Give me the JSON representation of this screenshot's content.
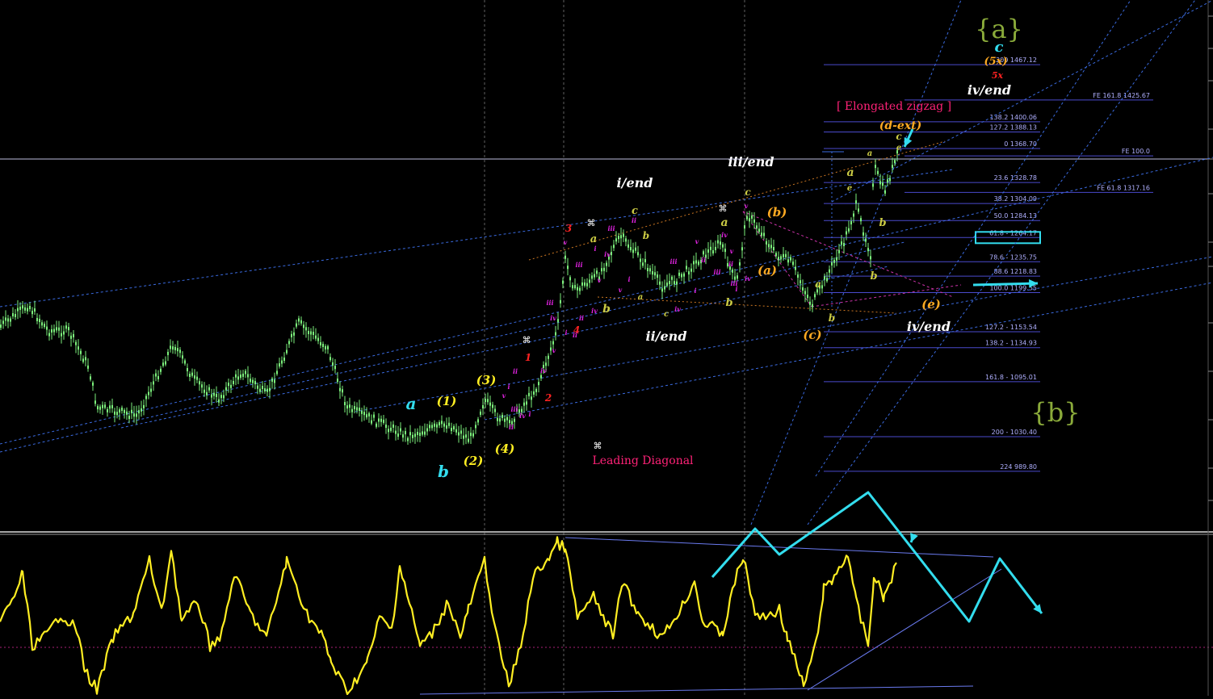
{
  "chart_data": {
    "type": "line",
    "title": "",
    "grid": false,
    "price_range": [
      960,
      1480
    ],
    "indicator_range": [
      0,
      100
    ],
    "fib_levels": [
      {
        "label": "200 1467.12",
        "price": 1467.12
      },
      {
        "label": "FE 161.8 1425.67",
        "price": 1425.67
      },
      {
        "label": "138.2 1400.06",
        "price": 1400.06
      },
      {
        "label": "127.2 1388.13",
        "price": 1388.13
      },
      {
        "label": "0 1368.70",
        "price": 1368.7
      },
      {
        "label": "FE 100.0",
        "price": 1360.0
      },
      {
        "label": "23.6 1328.78",
        "price": 1328.78
      },
      {
        "label": "FE 61.8 1317.16",
        "price": 1317.16
      },
      {
        "label": "38.2 1304.09",
        "price": 1304.09
      },
      {
        "label": "50.0 1284.13",
        "price": 1284.13
      },
      {
        "label": "61.8 - 1264.17",
        "price": 1264.17
      },
      {
        "label": "78.6 - 1235.75",
        "price": 1235.75
      },
      {
        "label": "88.6 1218.83",
        "price": 1218.83
      },
      {
        "label": "100.0 1199.55",
        "price": 1199.55
      },
      {
        "label": "127.2 - 1153.54",
        "price": 1153.54
      },
      {
        "label": "138.2 - 1134.93",
        "price": 1134.93
      },
      {
        "label": "161.8 - 1095.01",
        "price": 1095.01
      },
      {
        "label": "200 - 1030.40",
        "price": 1030.4
      },
      {
        "label": "224 989.80",
        "price": 989.8
      }
    ],
    "wave_labels": [
      {
        "text": "{a}",
        "color": "#8aaa3a"
      },
      {
        "text": "{b}",
        "color": "#8aaa3a"
      },
      {
        "text": "c",
        "color": "#33ddee"
      },
      {
        "text": "(5x)",
        "color": "#ffaa22"
      },
      {
        "text": "5x",
        "color": "#ff2222"
      },
      {
        "text": "iv/end",
        "color": "#ffffff"
      },
      {
        "text": "[ Elongated zigzag ]",
        "color": "#ff2277"
      },
      {
        "text": "(d-ext)",
        "color": "#ffaa22"
      },
      {
        "text": "c",
        "color": "#cccc44"
      },
      {
        "text": "e",
        "color": "#cccc44"
      },
      {
        "text": "a",
        "color": "#cccc44"
      },
      {
        "text": "a",
        "color": "#cccc44"
      },
      {
        "text": "e",
        "color": "#cccc44"
      },
      {
        "text": "b",
        "color": "#cccc44"
      },
      {
        "text": "b",
        "color": "#cccc44"
      },
      {
        "text": "iii/end",
        "color": "#ffffff"
      },
      {
        "text": "c",
        "color": "#cccc44"
      },
      {
        "text": "(b)",
        "color": "#ffaa22"
      },
      {
        "text": "a",
        "color": "#cccc44"
      },
      {
        "text": "(a)",
        "color": "#ffaa22"
      },
      {
        "text": "a",
        "color": "#cccc44"
      },
      {
        "text": "b",
        "color": "#cccc44"
      },
      {
        "text": "(c)",
        "color": "#ffaa22"
      },
      {
        "text": "(e)",
        "color": "#ffaa22"
      },
      {
        "text": "iv/end",
        "color": "#ffffff"
      },
      {
        "text": "i/end",
        "color": "#ffffff"
      },
      {
        "text": "c",
        "color": "#cccc44"
      },
      {
        "text": "a",
        "color": "#cccc44"
      },
      {
        "text": "b",
        "color": "#cccc44"
      },
      {
        "text": "b",
        "color": "#cccc44"
      },
      {
        "text": "a",
        "color": "#cccc44"
      },
      {
        "text": "c",
        "color": "#cccc44"
      },
      {
        "text": "b",
        "color": "#cccc44"
      },
      {
        "text": "ii/end",
        "color": "#ffffff"
      },
      {
        "text": "3",
        "color": "#ff2222"
      },
      {
        "text": "4",
        "color": "#ff2222"
      },
      {
        "text": "1",
        "color": "#ff2222"
      },
      {
        "text": "2",
        "color": "#ff2222"
      },
      {
        "text": "a",
        "color": "#33ddee"
      },
      {
        "text": "b",
        "color": "#33ddee"
      },
      {
        "text": "(1)",
        "color": "#ffee22"
      },
      {
        "text": "(2)",
        "color": "#ffee22"
      },
      {
        "text": "(3)",
        "color": "#ffee22"
      },
      {
        "text": "(4)",
        "color": "#ffee22"
      },
      {
        "text": "Leading Diagonal",
        "color": "#ff2277"
      }
    ],
    "micro_labels": [
      "iii",
      "iv",
      "v",
      "i",
      "ii",
      "iii",
      "iv",
      "v",
      "i",
      "ii",
      "iii",
      "iv",
      "v",
      "i",
      "ii",
      "iii",
      "iv",
      "v",
      "i",
      "ii",
      "iii",
      "iv",
      "v",
      "i",
      "ii",
      "iii",
      "iv",
      "v",
      "i",
      "ii",
      "iii",
      "iv",
      "v",
      "i",
      "ii",
      "iv",
      "v"
    ],
    "symbol": "⌘"
  }
}
